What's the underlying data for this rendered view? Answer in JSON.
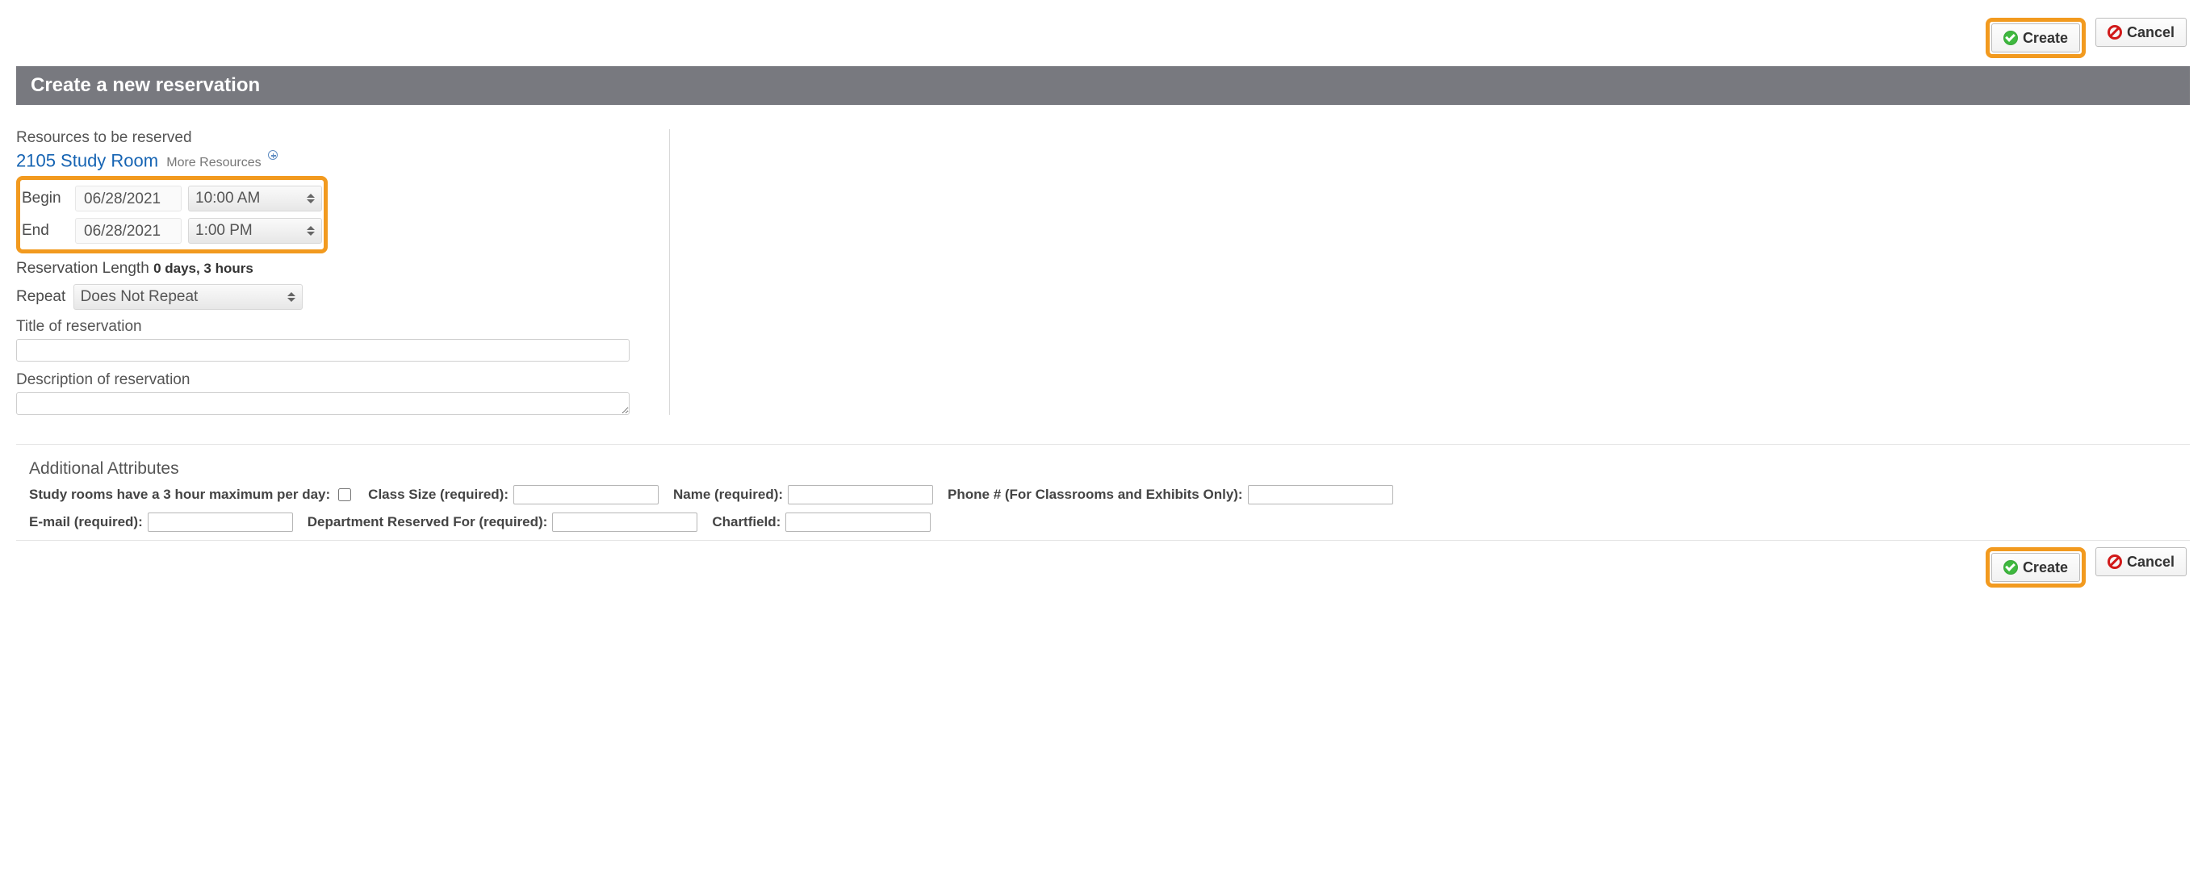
{
  "buttons": {
    "create": "Create",
    "cancel": "Cancel"
  },
  "header": {
    "title": "Create a new reservation"
  },
  "resources": {
    "label": "Resources to be reserved",
    "selected": "2105 Study Room",
    "more": "More Resources"
  },
  "datetime": {
    "begin_label": "Begin",
    "end_label": "End",
    "begin_date": "06/28/2021",
    "end_date": "06/28/2021",
    "begin_time": "10:00 AM",
    "end_time": "1:00 PM"
  },
  "length": {
    "label": "Reservation Length",
    "value": "0 days, 3 hours"
  },
  "repeat": {
    "label": "Repeat",
    "value": "Does Not Repeat"
  },
  "title_field": {
    "label": "Title of reservation",
    "value": ""
  },
  "description_field": {
    "label": "Description of reservation",
    "value": ""
  },
  "attributes": {
    "heading": "Additional Attributes",
    "study_max": "Study rooms have a 3 hour maximum per day:",
    "class_size": "Class Size (required):",
    "name": "Name (required):",
    "phone": "Phone # (For Classrooms and Exhibits Only):",
    "email": "E-mail (required):",
    "dept": "Department Reserved For (required):",
    "chartfield": "Chartfield:",
    "values": {
      "class_size": "",
      "name": "",
      "phone": "",
      "email": "",
      "dept": "",
      "chartfield": ""
    }
  }
}
